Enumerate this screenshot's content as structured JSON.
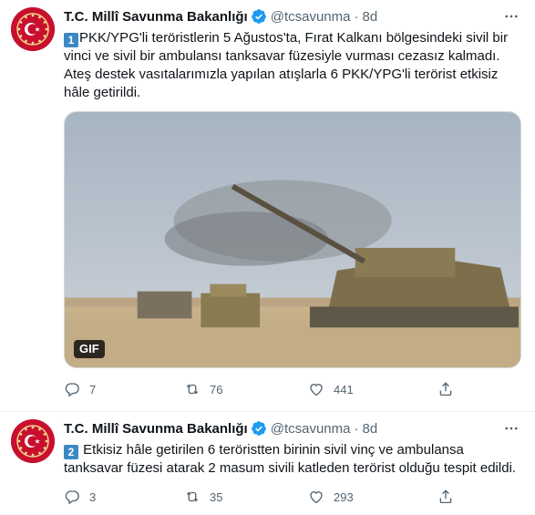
{
  "tweets": [
    {
      "author_name": "T.C. Millî Savunma Bakanlığı",
      "handle": "@tcsavunma",
      "separator": "·",
      "time": "8d",
      "number_emoji": "1",
      "text": "PKK/YPG'li teröristlerin 5 Ağustos'ta, Fırat Kalkanı bölgesindeki sivil bir vinci ve sivil bir ambulansı tanksavar füzesiyle vurması cezasız kalmadı. Ateş destek vasıtalarımızla yapılan atışlarla 6 PKK/YPG'li terörist etkisiz hâle getirildi.",
      "media_badge": "GIF",
      "replies": "7",
      "retweets": "76",
      "likes": "441"
    },
    {
      "author_name": "T.C. Millî Savunma Bakanlığı",
      "handle": "@tcsavunma",
      "separator": "·",
      "time": "8d",
      "number_emoji": "2",
      "text": " Etkisiz hâle getirilen 6 teröristten birinin sivil vinç ve ambulansa tanksavar füzesi atarak 2 masum sivili katleden terörist olduğu tespit edildi.",
      "replies": "3",
      "retweets": "35",
      "likes": "293"
    }
  ],
  "colors": {
    "verified": "#1d9bf0",
    "secondary_text": "#536471",
    "avatar_red": "#c8102e",
    "keycap_blue": "#3b88c3"
  },
  "icons": [
    "verified-badge-icon",
    "more-icon",
    "reply-icon",
    "retweet-icon",
    "like-icon",
    "share-icon",
    "ministry-emblem-icon"
  ]
}
